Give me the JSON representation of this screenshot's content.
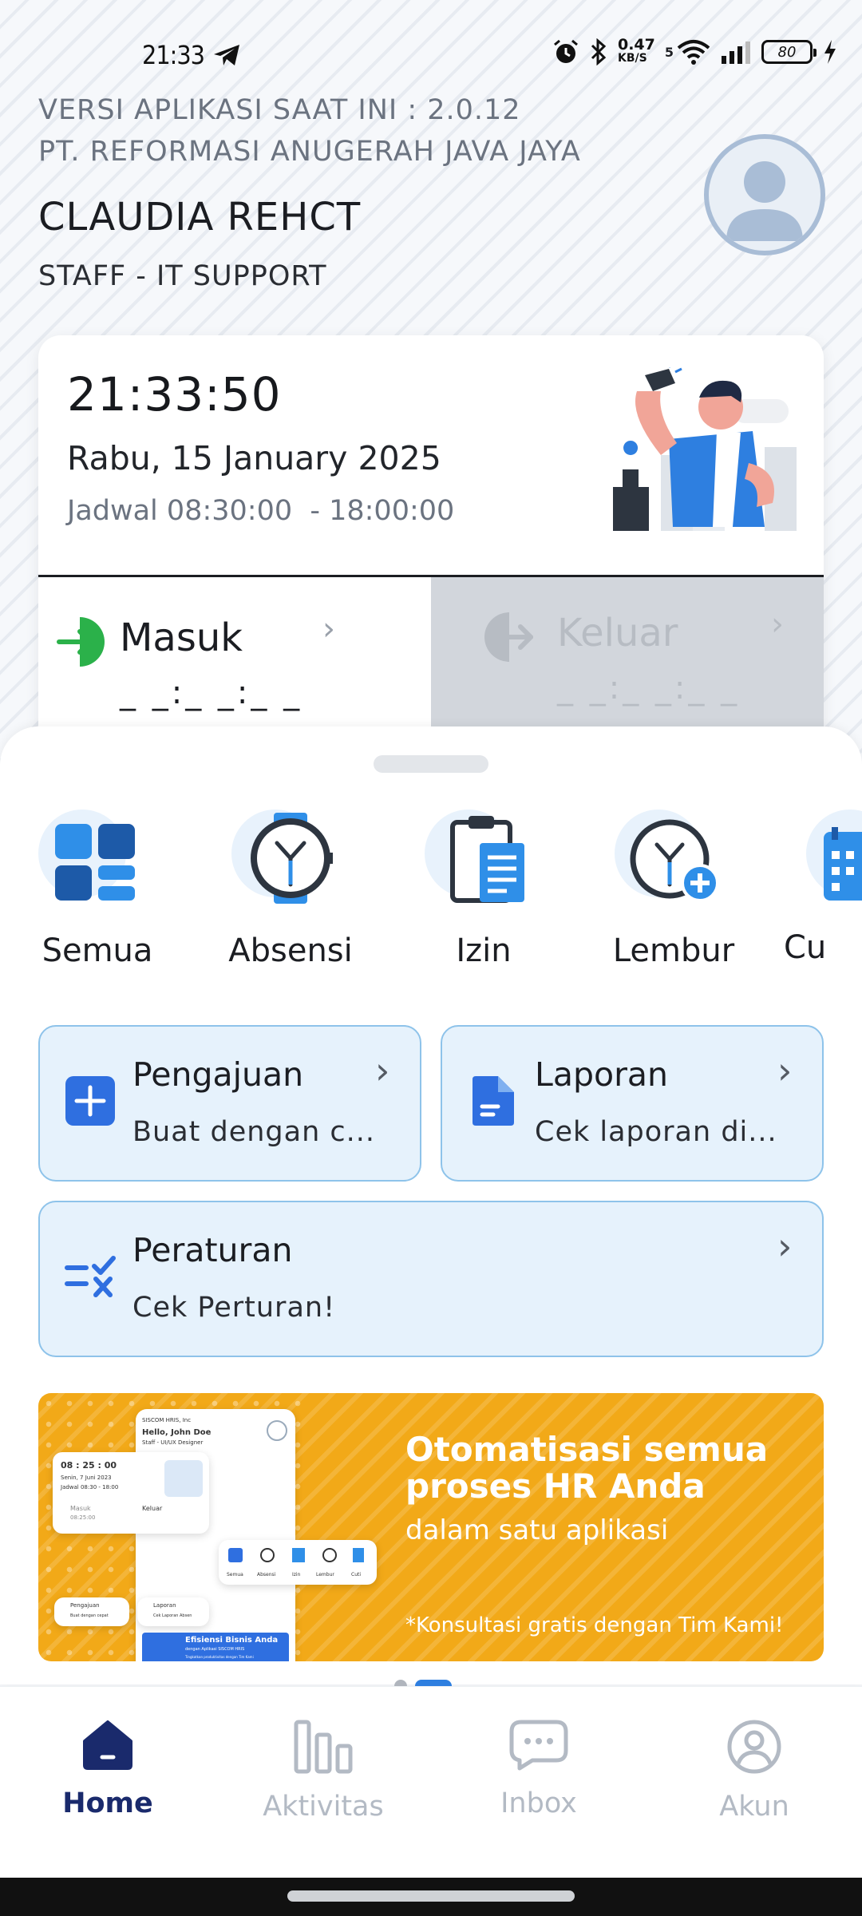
{
  "status_bar": {
    "time": "21:33",
    "speed_value": "0.47",
    "speed_unit": "KB/S",
    "network_sup": "5",
    "battery": "80"
  },
  "header": {
    "app_version": "VERSI APLIKASI SAAT INI : 2.0.12",
    "company": "PT. REFORMASI ANUGERAH JAVA JAYA",
    "user_name": "CLAUDIA REHCT",
    "user_role": "STAFF - IT SUPPORT"
  },
  "attendance": {
    "clock": "21:33:50",
    "date": "Rabu, 15 January 2025",
    "schedule": "Jadwal 08:30:00  - 18:00:00",
    "check_in_label": "Masuk",
    "check_in_time": "_ _:_ _:_ _",
    "check_out_label": "Keluar",
    "check_out_time": "_ _:_ _:_ _"
  },
  "menu": [
    {
      "label": "Semua"
    },
    {
      "label": "Absensi"
    },
    {
      "label": "Izin"
    },
    {
      "label": "Lembur"
    },
    {
      "label": "Cu"
    }
  ],
  "actions": {
    "pengajuan": {
      "title": "Pengajuan",
      "subtitle": "Buat dengan c..."
    },
    "laporan": {
      "title": "Laporan",
      "subtitle": "Cek laporan di..."
    },
    "peraturan": {
      "title": "Peraturan",
      "subtitle": "Cek Perturan!"
    }
  },
  "banner": {
    "headline_1": "Otomatisasi semua",
    "headline_2": "proses HR Anda",
    "sub": "dalam satu aplikasi",
    "note": "*Konsultasi gratis dengan Tim Kami!",
    "mock_company": "SISCOM HRIS, Inc",
    "mock_greeting": "Hello, John Doe",
    "mock_role": "Staff - UI/UX Designer",
    "mock_time": "08 : 25 : 00",
    "mock_date": "Senin, 7 Juni 2023",
    "mock_schedule": "Jadwal 08:30 - 18:00",
    "mock_in": "Masuk",
    "mock_in_time": "08:25:00",
    "mock_out": "Keluar",
    "mock_menu": [
      "Semua",
      "Absensi",
      "Izin",
      "Lembur",
      "Cuti"
    ],
    "mock_pengajuan": "Pengajuan",
    "mock_pengajuan_sub": "Buat dengan cepat",
    "mock_laporan": "Laporan",
    "mock_laporan_sub": "Cek Laporan Absen",
    "mock_efisiensi": "Efisiensi Bisnis Anda",
    "mock_efisiensi_sub": "dengan Aplikasi SISCOM HRIS",
    "mock_foot": "Tingkatkan produktivitas dengan Tim Kami"
  },
  "bottom_nav": [
    {
      "label": "Home",
      "active": true
    },
    {
      "label": "Aktivitas",
      "active": false
    },
    {
      "label": "Inbox",
      "active": false
    },
    {
      "label": "Akun",
      "active": false
    }
  ],
  "colors": {
    "primary": "#2e7fe0",
    "nav_active": "#1a2a6c",
    "check_in_green": "#2bb14a",
    "banner": "#f2a918",
    "card_bg": "#e6f2fc"
  }
}
